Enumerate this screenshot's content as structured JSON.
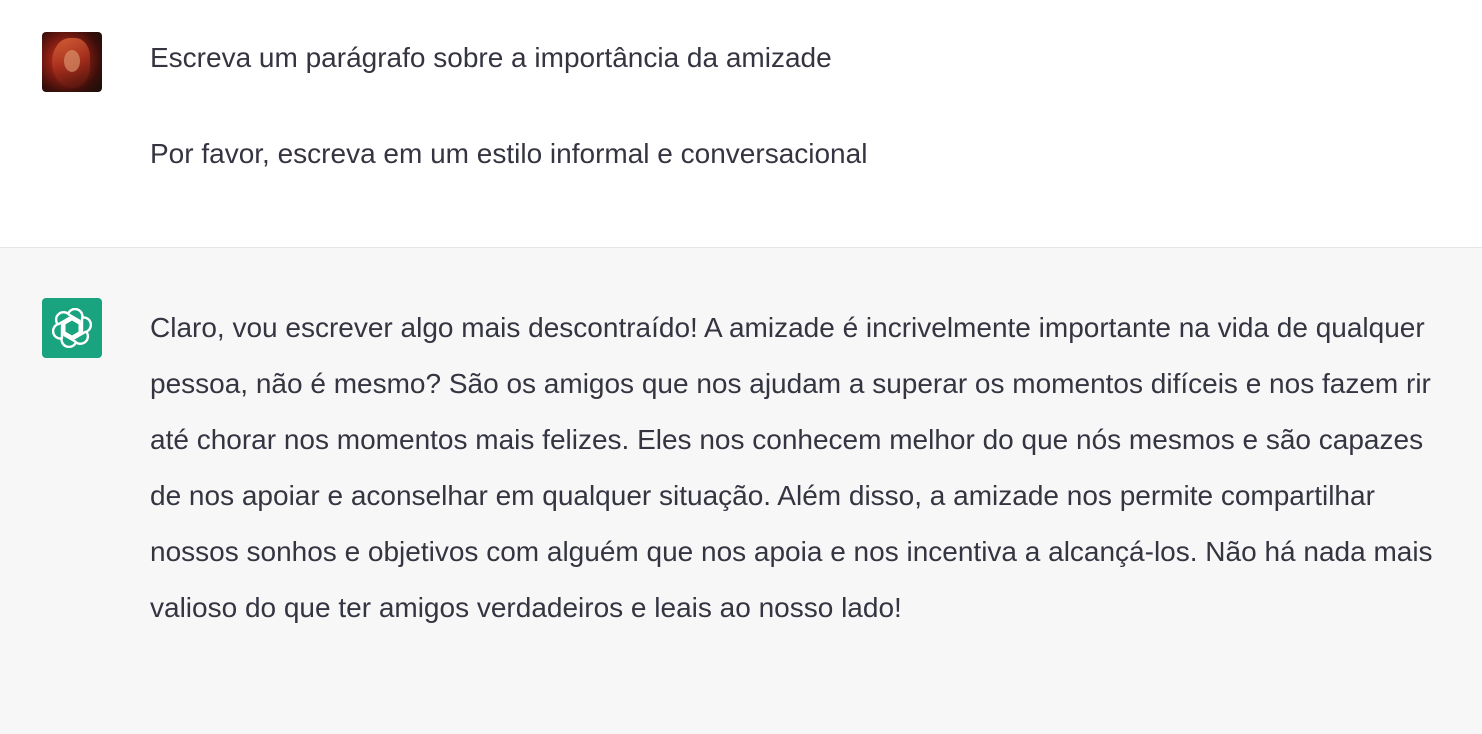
{
  "conversation": {
    "user_message": {
      "line1": "Escreva um parágrafo sobre a importância da amizade",
      "line2": "Por favor, escreva em um estilo informal e conversacional"
    },
    "assistant_message": {
      "text": "Claro, vou escrever algo mais descontraído! A amizade é incrivelmente importante na vida de qualquer pessoa, não é mesmo? São os amigos que nos ajudam a superar os momentos difíceis e nos fazem rir até chorar nos momentos mais felizes. Eles nos conhecem melhor do que nós mesmos e são capazes de nos apoiar e aconselhar em qualquer situação. Além disso, a amizade nos permite compartilhar nossos sonhos e objetivos com alguém que nos apoia e nos incentiva a alcançá-los. Não há nada mais valioso do que ter amigos verdadeiros e leais ao nosso lado!"
    }
  },
  "colors": {
    "assistant_avatar_bg": "#19a37f",
    "assistant_turn_bg": "#f7f7f8",
    "text": "#343541"
  },
  "icons": {
    "user_avatar": "user-photo-avatar",
    "assistant_avatar": "openai-logo-icon"
  }
}
